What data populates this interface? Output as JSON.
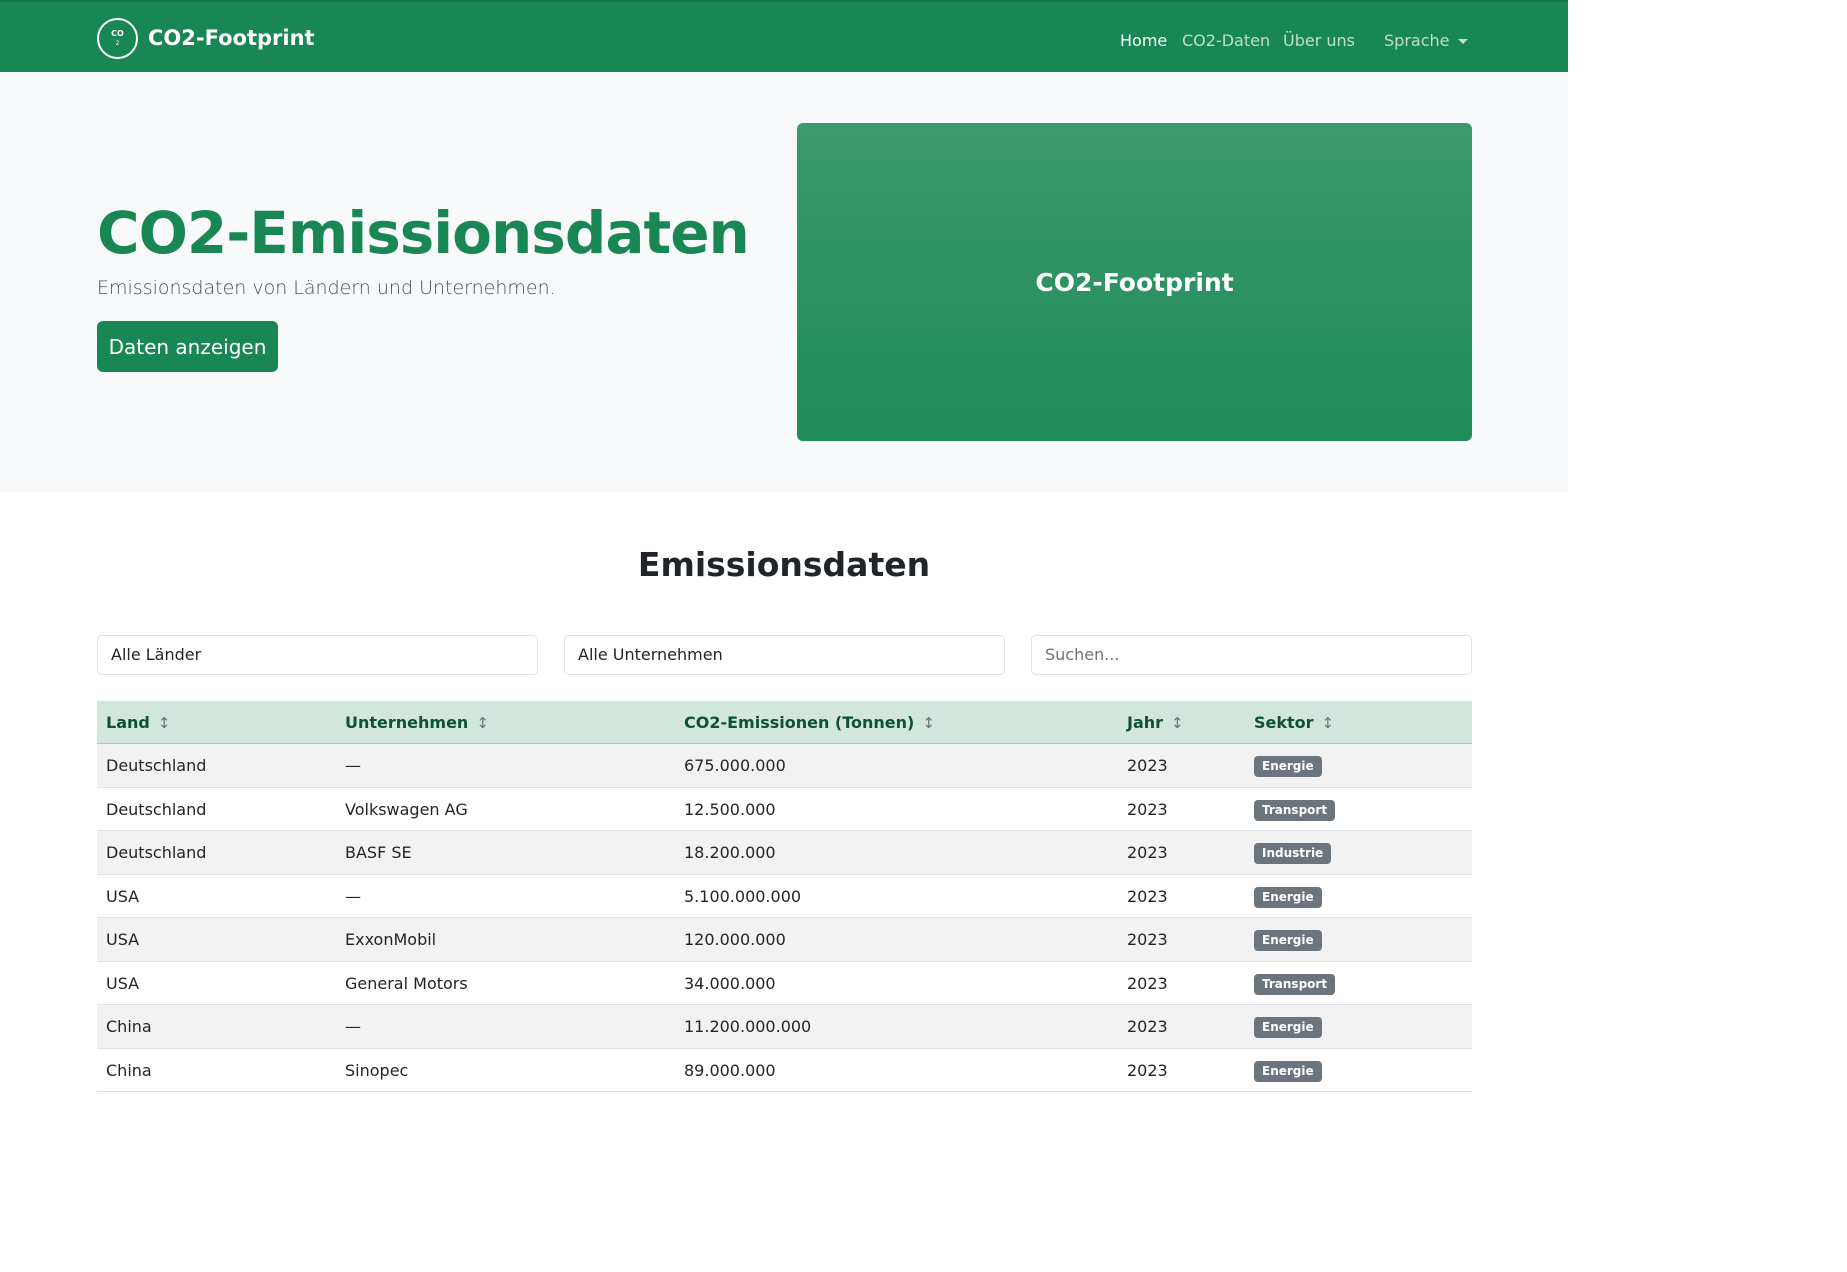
{
  "navbar": {
    "logo_text": "CO",
    "logo_sub": "2",
    "brand": "CO2-Footprint",
    "links": [
      "Home",
      "CO2-Daten",
      "Über uns"
    ],
    "language_label": "Sprache"
  },
  "hero": {
    "title": "CO2-Emissionsdaten",
    "subtitle": "Emissionsdaten von Ländern und Unternehmen.",
    "button_label": "Daten anzeigen",
    "box_label": "CO2-Footprint"
  },
  "data_section": {
    "title": "Emissionsdaten",
    "filters": {
      "country_selected": "Alle Länder",
      "company_selected": "Alle Unternehmen",
      "search_placeholder": "Suchen..."
    },
    "columns": [
      "Land",
      "Unternehmen",
      "CO2-Emissionen (Tonnen)",
      "Jahr",
      "Sektor"
    ],
    "rows": [
      {
        "land": "Deutschland",
        "unternehmen": "—",
        "emissionen": "675.000.000",
        "jahr": "2023",
        "sektor": "Energie"
      },
      {
        "land": "Deutschland",
        "unternehmen": "Volkswagen AG",
        "emissionen": "12.500.000",
        "jahr": "2023",
        "sektor": "Transport"
      },
      {
        "land": "Deutschland",
        "unternehmen": "BASF SE",
        "emissionen": "18.200.000",
        "jahr": "2023",
        "sektor": "Industrie"
      },
      {
        "land": "USA",
        "unternehmen": "—",
        "emissionen": "5.100.000.000",
        "jahr": "2023",
        "sektor": "Energie"
      },
      {
        "land": "USA",
        "unternehmen": "ExxonMobil",
        "emissionen": "120.000.000",
        "jahr": "2023",
        "sektor": "Energie"
      },
      {
        "land": "USA",
        "unternehmen": "General Motors",
        "emissionen": "34.000.000",
        "jahr": "2023",
        "sektor": "Transport"
      },
      {
        "land": "China",
        "unternehmen": "—",
        "emissionen": "11.200.000.000",
        "jahr": "2023",
        "sektor": "Energie"
      },
      {
        "land": "China",
        "unternehmen": "Sinopec",
        "emissionen": "89.000.000",
        "jahr": "2023",
        "sektor": "Energie"
      }
    ]
  },
  "colors": {
    "primary": "#198754",
    "header_row": "#d1e7dd",
    "badge": "#6c757d"
  }
}
